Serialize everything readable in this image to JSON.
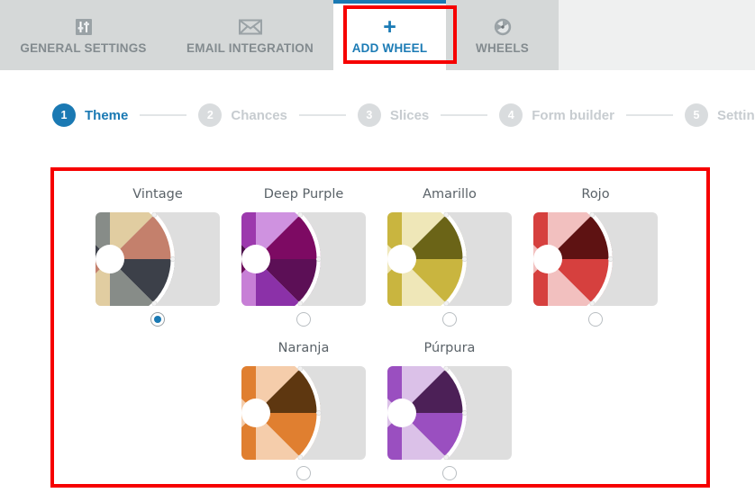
{
  "tabs": [
    {
      "id": "general-settings",
      "label": "GENERAL SETTINGS",
      "icon": "sliders-icon",
      "active": false
    },
    {
      "id": "email-integration",
      "label": "EMAIL INTEGRATION",
      "icon": "envelope-icon",
      "active": false
    },
    {
      "id": "add-wheel",
      "label": "ADD WHEEL",
      "icon": "plus-icon",
      "active": true
    },
    {
      "id": "wheels",
      "label": "WHEELS",
      "icon": "wheel-icon",
      "active": false
    }
  ],
  "stepper": {
    "steps": [
      {
        "number": "1",
        "label": "Theme",
        "active": true
      },
      {
        "number": "2",
        "label": "Chances",
        "active": false
      },
      {
        "number": "3",
        "label": "Slices",
        "active": false
      },
      {
        "number": "4",
        "label": "Form builder",
        "active": false
      },
      {
        "number": "5",
        "label": "Settings",
        "active": false
      }
    ]
  },
  "colors": {
    "accent": "#1a79b3",
    "annotation": "#f60000",
    "tabbar_bg": "#d5d8d8",
    "card_bg": "#dedede",
    "step_inactive": "#d9dcde"
  },
  "themes": [
    {
      "id": "vintage",
      "name": "Vintage",
      "selected": true,
      "slices": [
        "#3c4049",
        "#878c88",
        "#e1cda1",
        "#c4806c",
        "#3c4049",
        "#878c88",
        "#e1cda1",
        "#c4806c"
      ],
      "rim": "#ffffff"
    },
    {
      "id": "deep-purple",
      "name": "Deep Purple",
      "selected": false,
      "slices": [
        "#4a0d4a",
        "#9c39ad",
        "#cf92e0",
        "#7d0a63",
        "#5c0f56",
        "#8b31a8",
        "#c77fd6",
        "#6d0a5b"
      ],
      "rim": "#ffffff"
    },
    {
      "id": "amarillo",
      "name": "Amarillo",
      "selected": false,
      "slices": [
        "#efe7b8",
        "#c9b53f",
        "#efe7b8",
        "#6b6417",
        "#c9b53f",
        "#efe7b8",
        "#c9b53f",
        "#efe7b8"
      ],
      "rim": "#ffffff"
    },
    {
      "id": "rojo",
      "name": "Rojo",
      "selected": false,
      "slices": [
        "#f2c0bf",
        "#d6403e",
        "#f2c0bf",
        "#5e1212",
        "#d6403e",
        "#f2c0bf",
        "#d6403e",
        "#f2c0bf"
      ],
      "rim": "#ffffff"
    },
    {
      "id": "naranja",
      "name": "Naranja",
      "selected": false,
      "slices": [
        "#f5cdab",
        "#e07f30",
        "#f5cdab",
        "#5e3710",
        "#e07f30",
        "#f5cdab",
        "#e07f30",
        "#f5cdab"
      ],
      "rim": "#ffffff"
    },
    {
      "id": "purpura",
      "name": "Púrpura",
      "selected": false,
      "slices": [
        "#dbc1e8",
        "#9a4fc0",
        "#dbc1e8",
        "#4c2057",
        "#9a4fc0",
        "#dbc1e8",
        "#9a4fc0",
        "#dbc1e8"
      ],
      "rim": "#ffffff"
    }
  ]
}
